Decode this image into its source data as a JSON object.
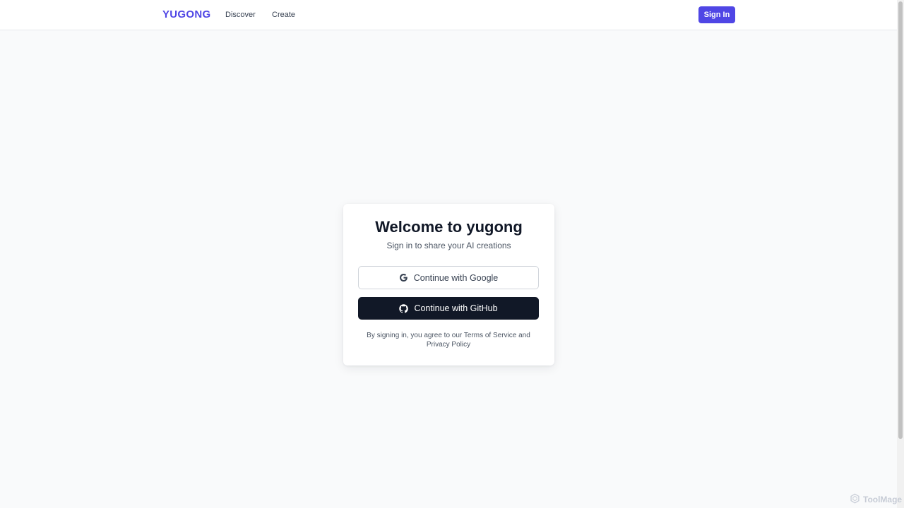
{
  "nav": {
    "brand": "YUGONG",
    "links": [
      "Discover",
      "Create"
    ],
    "signin_label": "Sign In"
  },
  "auth_card": {
    "title": "Welcome to yugong",
    "subtitle": "Sign in to share your AI creations",
    "google_label": "Continue with Google",
    "github_label": "Continue with GitHub",
    "legal_prefix": "By signing in, you agree to our",
    "terms_label": "Terms of Service",
    "legal_and": "and",
    "privacy_label": "Privacy Policy"
  },
  "watermark": "ToolMage",
  "colors": {
    "accent": "#4f46e5",
    "github_button": "#111827",
    "background": "#f9fafb"
  },
  "icons": {
    "google": "google-g-icon",
    "github": "github-icon",
    "watermark": "hexagon-logo-icon"
  }
}
